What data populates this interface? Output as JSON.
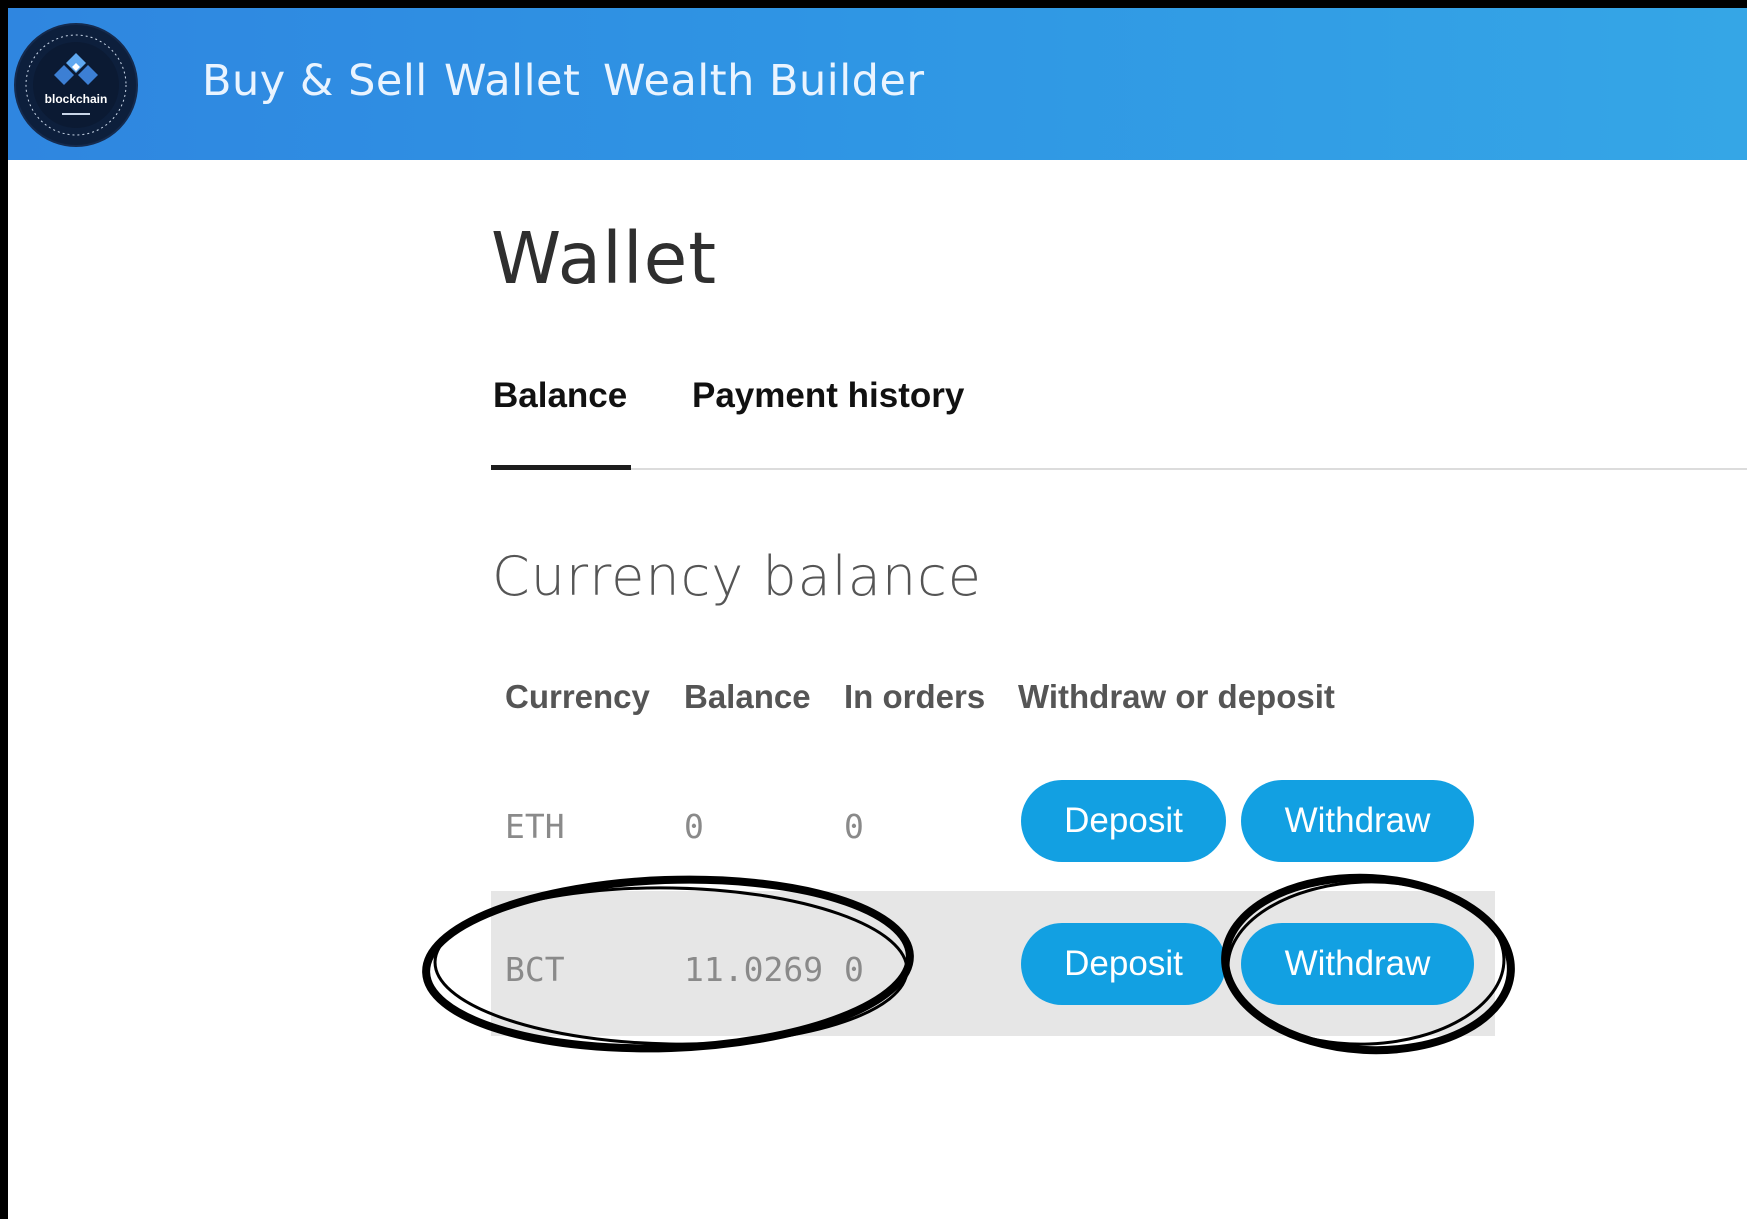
{
  "navbar": {
    "logo_label": "blockchain",
    "links": [
      "Buy & Sell",
      "Wallet",
      "Wealth Builder"
    ]
  },
  "page": {
    "title": "Wallet",
    "tabs": [
      {
        "label": "Balance",
        "active": true
      },
      {
        "label": "Payment history",
        "active": false
      }
    ],
    "section_title": "Currency balance"
  },
  "table": {
    "headers": [
      "Currency",
      "Balance",
      "In orders",
      "Withdraw or deposit"
    ],
    "rows": [
      {
        "currency": "ETH",
        "balance": "0",
        "in_orders": "0",
        "deposit_label": "Deposit",
        "withdraw_label": "Withdraw"
      },
      {
        "currency": "BCT",
        "balance": "11.0269",
        "in_orders": "0",
        "deposit_label": "Deposit",
        "withdraw_label": "Withdraw"
      }
    ]
  },
  "colors": {
    "navbar_start": "#2f86e0",
    "navbar_end": "#35a6e6",
    "button": "#12a0e2",
    "highlight_row": "#e6e6e6",
    "annotation_ink": "#000000"
  }
}
